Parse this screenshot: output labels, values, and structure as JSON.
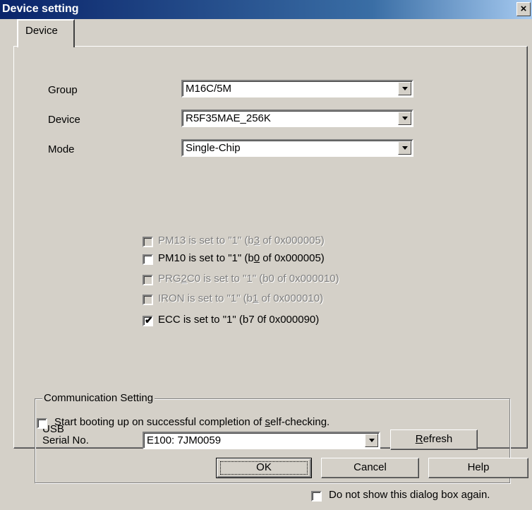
{
  "window": {
    "title": "Device setting",
    "close_glyph": "×"
  },
  "tab": {
    "label": "Device"
  },
  "fields": {
    "group": {
      "label": "Group",
      "value": "M16C/5M"
    },
    "device": {
      "label": "Device",
      "value": "R5F35MAE_256K"
    },
    "mode": {
      "label": "Mode",
      "value": "Single-Chip"
    }
  },
  "options": [
    {
      "prefix": "PM13 is set to \"1\" (b",
      "key": "3",
      "suffix": " of 0x000005)",
      "checked": false,
      "enabled": false
    },
    {
      "prefix": "PM10 is set to \"1\" (b",
      "key": "0",
      "suffix": " of 0x000005)",
      "checked": false,
      "enabled": true
    },
    {
      "prefix": "PRG",
      "key": "2",
      "suffix": "C0 is set to \"1\" (b0 of 0x000010)",
      "checked": false,
      "enabled": false
    },
    {
      "prefix": "IRON is set to \"1\" (b",
      "key": "1",
      "suffix": " of 0x000010)",
      "checked": false,
      "enabled": false
    },
    {
      "prefix": "ECC is set to \"1\" (b7 0f 0x000090)",
      "key": "",
      "suffix": "",
      "checked": true,
      "enabled": true
    }
  ],
  "communication": {
    "title": "Communication Setting",
    "usb_label_line1": "USB",
    "usb_label_line2": "Serial No.",
    "serial_value": "E100: 7JM0059",
    "refresh_key": "R",
    "refresh_rest": "efresh"
  },
  "boot": {
    "prefix": "Start booting up on successful completion of ",
    "key": "s",
    "suffix": "elf-checking.",
    "checked": false
  },
  "buttons": {
    "ok": "OK",
    "cancel": "Cancel",
    "help": "Help"
  },
  "dont_show": {
    "label": "Do not show this dialog box again.",
    "checked": false
  },
  "check_glyph": "✔"
}
